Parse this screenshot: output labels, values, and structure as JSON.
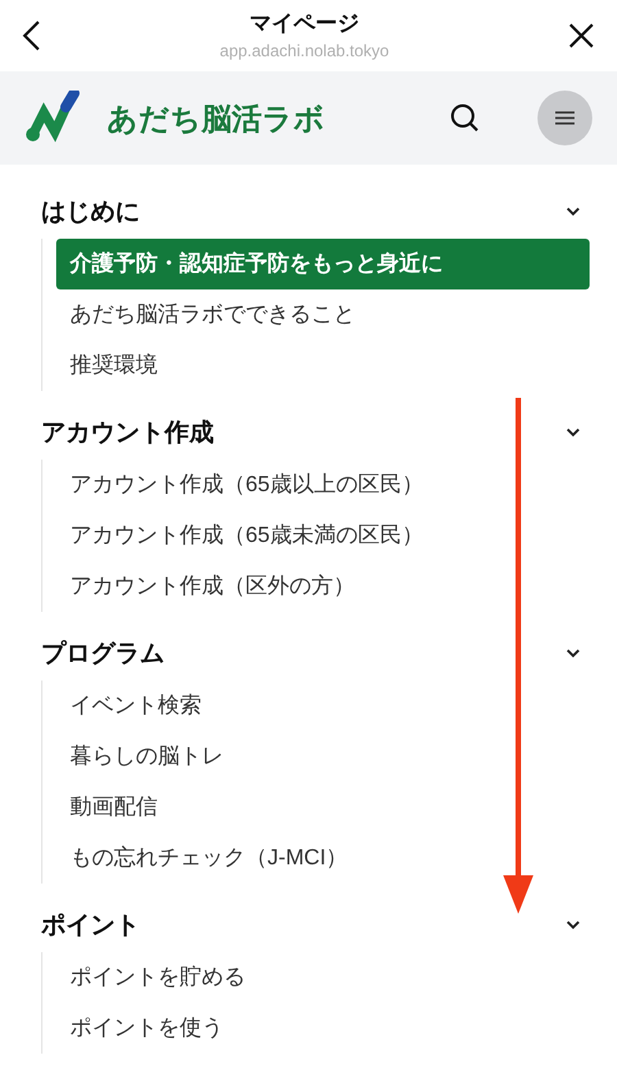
{
  "top_bar": {
    "title": "マイページ",
    "url": "app.adachi.nolab.tokyo"
  },
  "header": {
    "site_name": "あだち脳活ラボ"
  },
  "menu": [
    {
      "heading": "はじめに",
      "items": [
        {
          "label": "介護予防・認知症予防をもっと身近に",
          "selected": true
        },
        {
          "label": "あだち脳活ラボでできること",
          "selected": false
        },
        {
          "label": "推奨環境",
          "selected": false
        }
      ]
    },
    {
      "heading": "アカウント作成",
      "items": [
        {
          "label": "アカウント作成（65歳以上の区民）",
          "selected": false
        },
        {
          "label": "アカウント作成（65歳未満の区民）",
          "selected": false
        },
        {
          "label": "アカウント作成（区外の方）",
          "selected": false
        }
      ]
    },
    {
      "heading": "プログラム",
      "items": [
        {
          "label": "イベント検索",
          "selected": false
        },
        {
          "label": "暮らしの脳トレ",
          "selected": false
        },
        {
          "label": "動画配信",
          "selected": false
        },
        {
          "label": "もの忘れチェック（J-MCI）",
          "selected": false
        }
      ]
    },
    {
      "heading": "ポイント",
      "items": [
        {
          "label": "ポイントを貯める",
          "selected": false
        },
        {
          "label": "ポイントを使う",
          "selected": false
        }
      ]
    }
  ]
}
